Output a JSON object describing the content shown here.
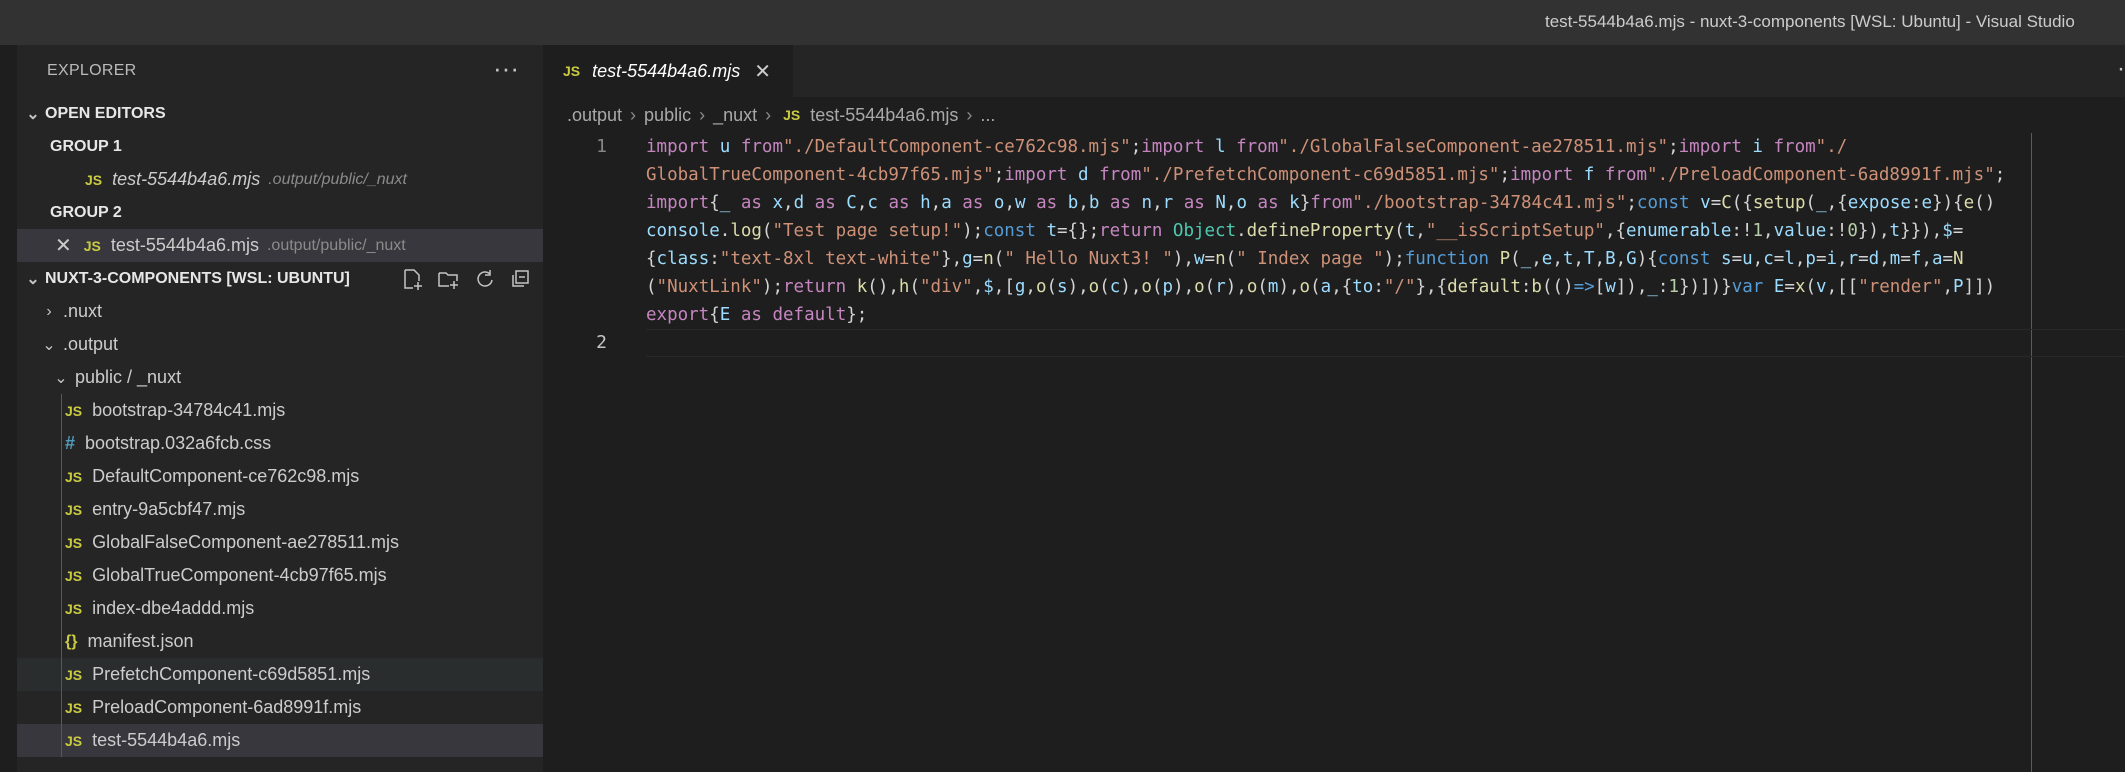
{
  "window": {
    "title": "test-5544b4a6.mjs - nuxt-3-components [WSL: Ubuntu] - Visual Studio"
  },
  "explorer": {
    "title": "EXPLORER",
    "more_glyph": "···",
    "open_editors": {
      "label": "OPEN EDITORS",
      "group1": {
        "label": "GROUP 1",
        "file": "test-5544b4a6.mjs",
        "path": ".output/public/_nuxt"
      },
      "group2": {
        "label": "GROUP 2",
        "file": "test-5544b4a6.mjs",
        "path": ".output/public/_nuxt"
      }
    },
    "workspace": {
      "label": "NUXT-3-COMPONENTS [WSL: UBUNTU]",
      "folders": {
        "nuxt": ".nuxt",
        "output": ".output",
        "public_nuxt": "public / _nuxt"
      },
      "files": [
        {
          "name": "bootstrap-34784c41.mjs",
          "icon": "JS"
        },
        {
          "name": "bootstrap.032a6fcb.css",
          "icon": "#"
        },
        {
          "name": "DefaultComponent-ce762c98.mjs",
          "icon": "JS"
        },
        {
          "name": "entry-9a5cbf47.mjs",
          "icon": "JS"
        },
        {
          "name": "GlobalFalseComponent-ae278511.mjs",
          "icon": "JS"
        },
        {
          "name": "GlobalTrueComponent-4cb97f65.mjs",
          "icon": "JS"
        },
        {
          "name": "index-dbe4addd.mjs",
          "icon": "JS"
        },
        {
          "name": "manifest.json",
          "icon": "{}"
        },
        {
          "name": "PrefetchComponent-c69d5851.mjs",
          "icon": "JS"
        },
        {
          "name": "PreloadComponent-6ad8991f.mjs",
          "icon": "JS"
        },
        {
          "name": "test-5544b4a6.mjs",
          "icon": "JS"
        }
      ]
    }
  },
  "tab": {
    "icon": "JS",
    "name": "test-5544b4a6.mjs",
    "close": "✕"
  },
  "breadcrumb": {
    "items": [
      ".output",
      "public",
      "_nuxt"
    ],
    "file": "test-5544b4a6.mjs",
    "tail": "..."
  },
  "editor": {
    "line_numbers": [
      "1",
      "2"
    ],
    "accent_colors": {
      "keyword": "#c586c0",
      "string": "#ce9178",
      "variable": "#9cdcfe",
      "function": "#dcdcaa"
    }
  }
}
